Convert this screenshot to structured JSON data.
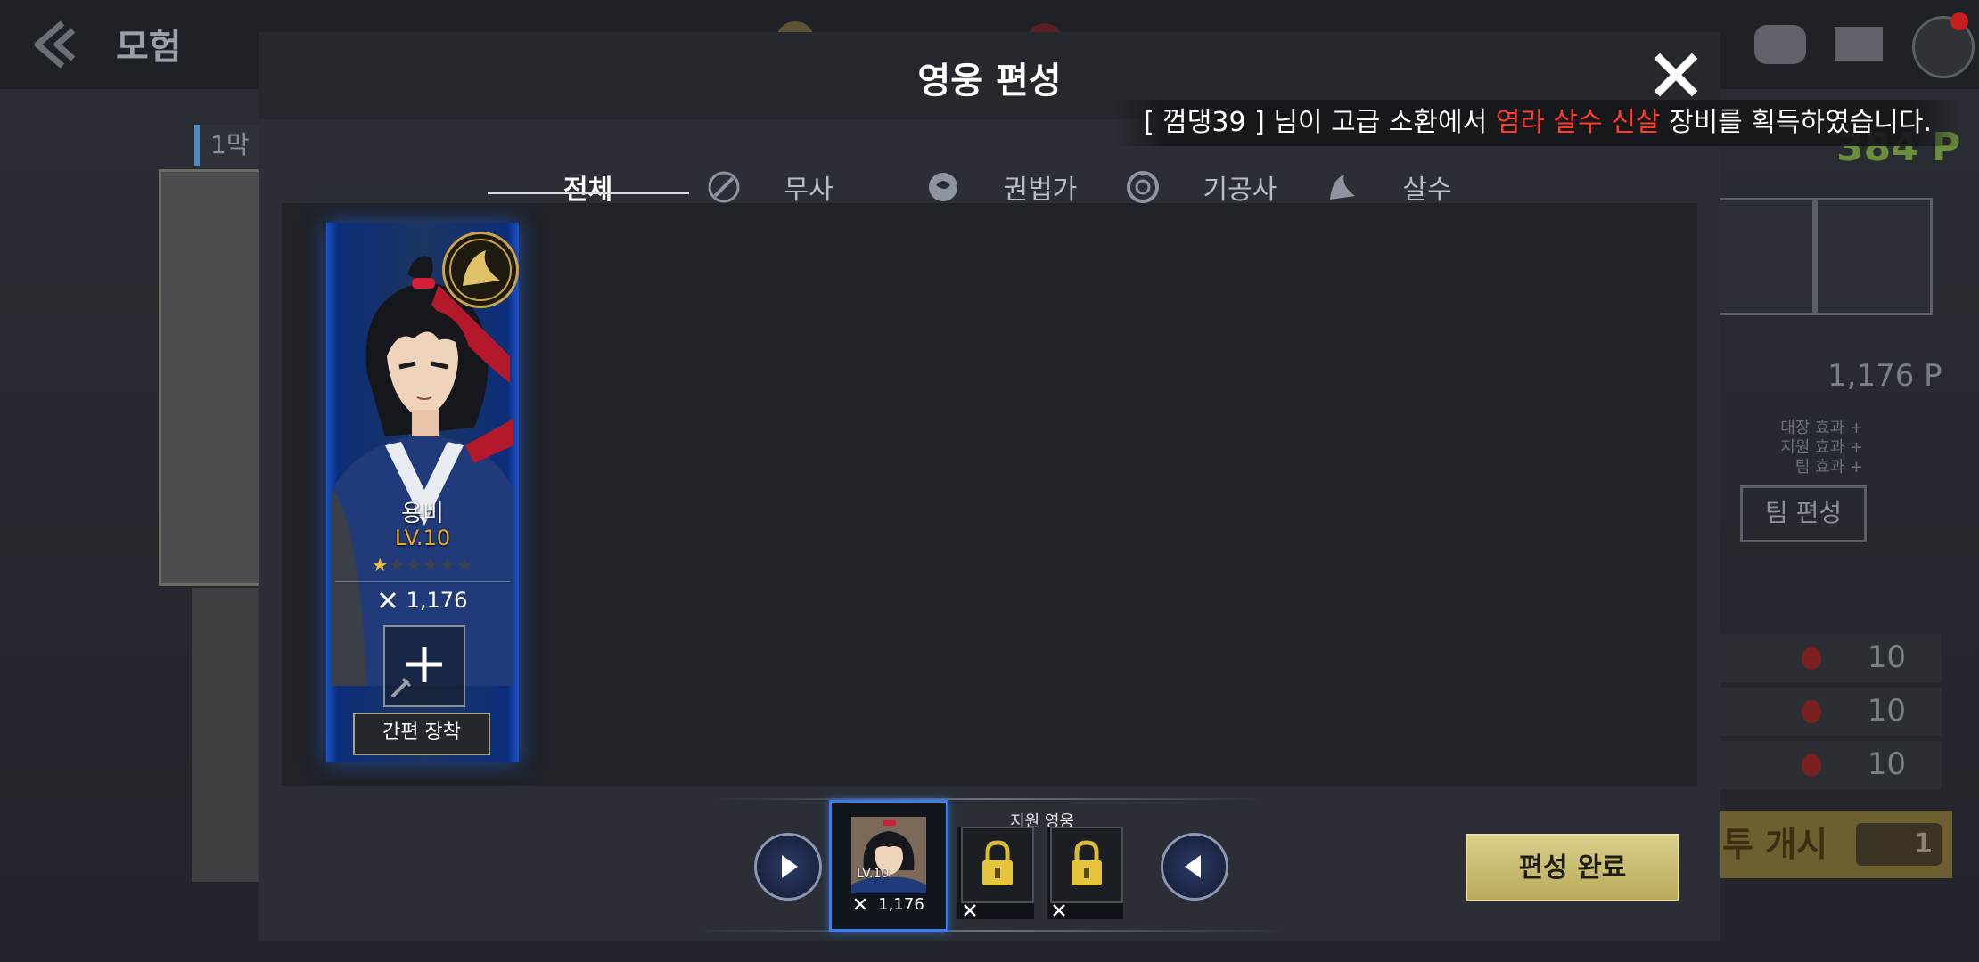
{
  "background": {
    "title": "모험",
    "stage_label": "1막",
    "points": "384 P",
    "power": "1,176 P",
    "effects": [
      "대장 효과 +",
      "지원 효과 +",
      "팀 효과 +"
    ],
    "team_button": "팀 편성",
    "rows": [
      "10",
      "10",
      "10"
    ],
    "start_button": "투 개시",
    "start_cost": "1"
  },
  "modal": {
    "title": "영웅 편성",
    "notice": {
      "prefix": "[ 껌댕39 ] 님이 고급 소환에서 ",
      "highlight": "염라 살수 신살",
      "suffix": " 장비를 획득하였습니다."
    },
    "tabs": [
      {
        "label": "전체",
        "icon": ""
      },
      {
        "label": "무사",
        "icon": "sword-class-icon"
      },
      {
        "label": "권법가",
        "icon": "fist-class-icon"
      },
      {
        "label": "기공사",
        "icon": "qi-class-icon"
      },
      {
        "label": "살수",
        "icon": "assassin-class-icon"
      }
    ],
    "active_tab": "전체"
  },
  "hero_card": {
    "name": "용비",
    "level": "LV.10",
    "stars_filled": 1,
    "stars_total": 6,
    "power": "1,176",
    "quick_equip_label": "간편 장착"
  },
  "lineup": {
    "leader": {
      "level": "LV.10",
      "power": "1,176"
    },
    "support_label": "지원 영웅"
  },
  "finish_button": "편성 완료",
  "colors": {
    "accent_blue": "#3b7cf0",
    "notice_highlight": "#ff3b2b",
    "level_gold": "#e5a92c",
    "finish_button": "#c9bc70"
  }
}
